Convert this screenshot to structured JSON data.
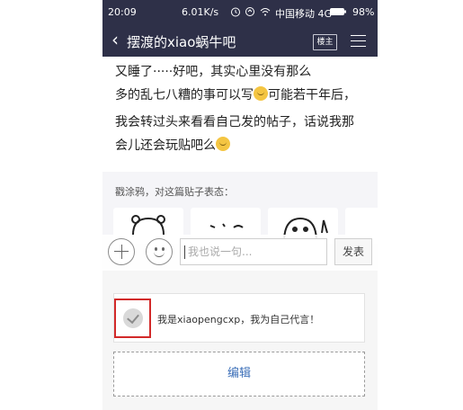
{
  "status": {
    "time": "20:09",
    "speed": "6.01K/s",
    "carrier": "中国移动 4G",
    "battery": "98%"
  },
  "nav": {
    "back": "‹",
    "title": "摆渡的xiao蜗牛吧",
    "owner_button": "楼主"
  },
  "post": {
    "line1": "又睡了·····好吧，其实心里没有那么",
    "line2": "多的乱七八糟的事可以写",
    "line2b": "可能若干年后，",
    "line3": "我会转过头来看看自己发的帖子，话说我那",
    "line4": "会儿还会玩贴吧么"
  },
  "doodle": {
    "label": "戳涂鸦，对这篇贴子表态："
  },
  "reply": {
    "placeholder": "我也说一句...",
    "send": "发表"
  },
  "identity": {
    "text": "我是xiaopengcxp，我为自己代言！"
  },
  "edit": {
    "label": "编辑"
  },
  "colors": {
    "nav": "#2e3048",
    "highlight": "#d22a2a",
    "link": "#3c6fb8"
  }
}
